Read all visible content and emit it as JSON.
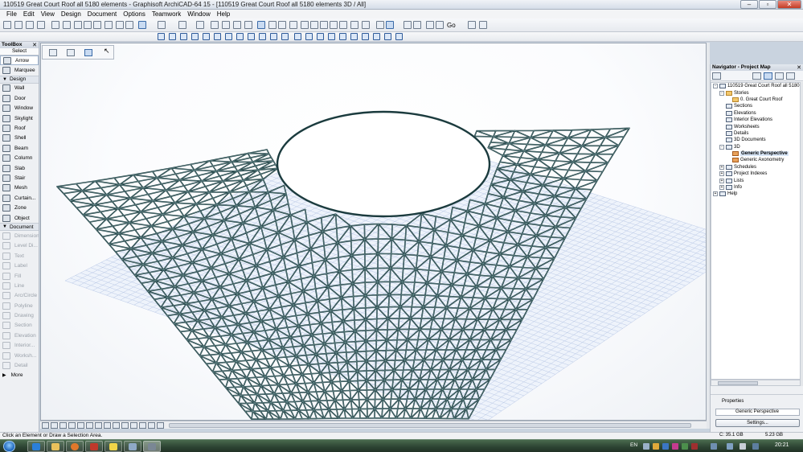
{
  "window": {
    "title": "110519 Great Court Roof all 5180 elements - Graphisoft ArchiCAD-64 15 - [110519 Great Court Roof all 5180 elements 3D / All]"
  },
  "menu": [
    "File",
    "Edit",
    "View",
    "Design",
    "Document",
    "Options",
    "Teamwork",
    "Window",
    "Help"
  ],
  "toolbar": {
    "go_label": "Go"
  },
  "toolbox": {
    "title": "ToolBox",
    "select_label": "Select",
    "items_top": [
      {
        "label": "Arrow",
        "icon": "arrow-icon",
        "selected": true
      },
      {
        "label": "Marquee",
        "icon": "marquee-icon"
      }
    ],
    "design_group": "Design",
    "design_items": [
      {
        "label": "Wall",
        "icon": "wall-icon"
      },
      {
        "label": "Door",
        "icon": "door-icon"
      },
      {
        "label": "Window",
        "icon": "window-icon"
      },
      {
        "label": "Skylight",
        "icon": "skylight-icon"
      },
      {
        "label": "Roof",
        "icon": "roof-icon"
      },
      {
        "label": "Shell",
        "icon": "shell-icon"
      },
      {
        "label": "Beam",
        "icon": "beam-icon"
      },
      {
        "label": "Column",
        "icon": "column-icon"
      },
      {
        "label": "Slab",
        "icon": "slab-icon"
      },
      {
        "label": "Stair",
        "icon": "stair-icon"
      },
      {
        "label": "Mesh",
        "icon": "mesh-icon"
      },
      {
        "label": "Curtain...",
        "icon": "curtain-wall-icon"
      },
      {
        "label": "Zone",
        "icon": "zone-icon"
      },
      {
        "label": "Object",
        "icon": "object-icon"
      }
    ],
    "document_group": "Document",
    "document_items": [
      {
        "label": "Dimension",
        "icon": "dimension-icon"
      },
      {
        "label": "Level Di...",
        "icon": "level-dimension-icon"
      },
      {
        "label": "Text",
        "icon": "text-icon"
      },
      {
        "label": "Label",
        "icon": "label-icon"
      },
      {
        "label": "Fill",
        "icon": "fill-icon"
      },
      {
        "label": "Line",
        "icon": "line-icon"
      },
      {
        "label": "Arc/Circle",
        "icon": "arc-icon"
      },
      {
        "label": "Polyline",
        "icon": "polyline-icon"
      },
      {
        "label": "Drawing",
        "icon": "drawing-icon"
      },
      {
        "label": "Section",
        "icon": "section-icon"
      },
      {
        "label": "Elevation",
        "icon": "elevation-icon"
      },
      {
        "label": "Interior...",
        "icon": "interior-elevation-icon"
      },
      {
        "label": "Worksh...",
        "icon": "worksheet-icon"
      },
      {
        "label": "Detail",
        "icon": "detail-icon"
      }
    ],
    "more_label": "More"
  },
  "navigator": {
    "title": "Navigator - Project Map",
    "tree": [
      {
        "label": "110519 Great Court Roof all 5180 elements",
        "indent": 0,
        "exp": "-",
        "icon": "project-icon"
      },
      {
        "label": "Stories",
        "indent": 1,
        "exp": "-",
        "icon": "stories-icon"
      },
      {
        "label": "0. Great Court Roof",
        "indent": 2,
        "exp": "",
        "icon": "story-icon"
      },
      {
        "label": "Sections",
        "indent": 1,
        "exp": "",
        "icon": "sections-icon"
      },
      {
        "label": "Elevations",
        "indent": 1,
        "exp": "",
        "icon": "elevations-icon"
      },
      {
        "label": "Interior Elevations",
        "indent": 1,
        "exp": "",
        "icon": "interior-elevations-icon"
      },
      {
        "label": "Worksheets",
        "indent": 1,
        "exp": "",
        "icon": "worksheets-icon"
      },
      {
        "label": "Details",
        "indent": 1,
        "exp": "",
        "icon": "details-icon"
      },
      {
        "label": "3D Documents",
        "indent": 1,
        "exp": "",
        "icon": "3d-documents-icon"
      },
      {
        "label": "3D",
        "indent": 1,
        "exp": "-",
        "icon": "3d-icon"
      },
      {
        "label": "Generic Perspective",
        "indent": 2,
        "exp": "",
        "icon": "perspective-icon",
        "selected": true
      },
      {
        "label": "Generic Axonometry",
        "indent": 2,
        "exp": "",
        "icon": "axonometry-icon"
      },
      {
        "label": "Schedules",
        "indent": 1,
        "exp": "+",
        "icon": "schedules-icon"
      },
      {
        "label": "Project Indexes",
        "indent": 1,
        "exp": "+",
        "icon": "project-indexes-icon"
      },
      {
        "label": "Lists",
        "indent": 1,
        "exp": "+",
        "icon": "lists-icon"
      },
      {
        "label": "Info",
        "indent": 1,
        "exp": "+",
        "icon": "info-icon"
      },
      {
        "label": "Help",
        "indent": 0,
        "exp": "+",
        "icon": "help-icon"
      }
    ],
    "properties_label": "Properties",
    "properties_value": "Generic Perspective",
    "settings_label": "Settings..."
  },
  "status": {
    "hint": "Click an Element or Draw a Selection Area.",
    "disk": "C: 35.1 GB",
    "memory": "5.23 GB"
  },
  "taskbar": {
    "lang": "EN",
    "clock": "20:21"
  },
  "colors": {
    "mesh_stroke": "#1b3b3e",
    "grid_stroke": "#b9c8e6",
    "accent": "#3a6aa7"
  }
}
